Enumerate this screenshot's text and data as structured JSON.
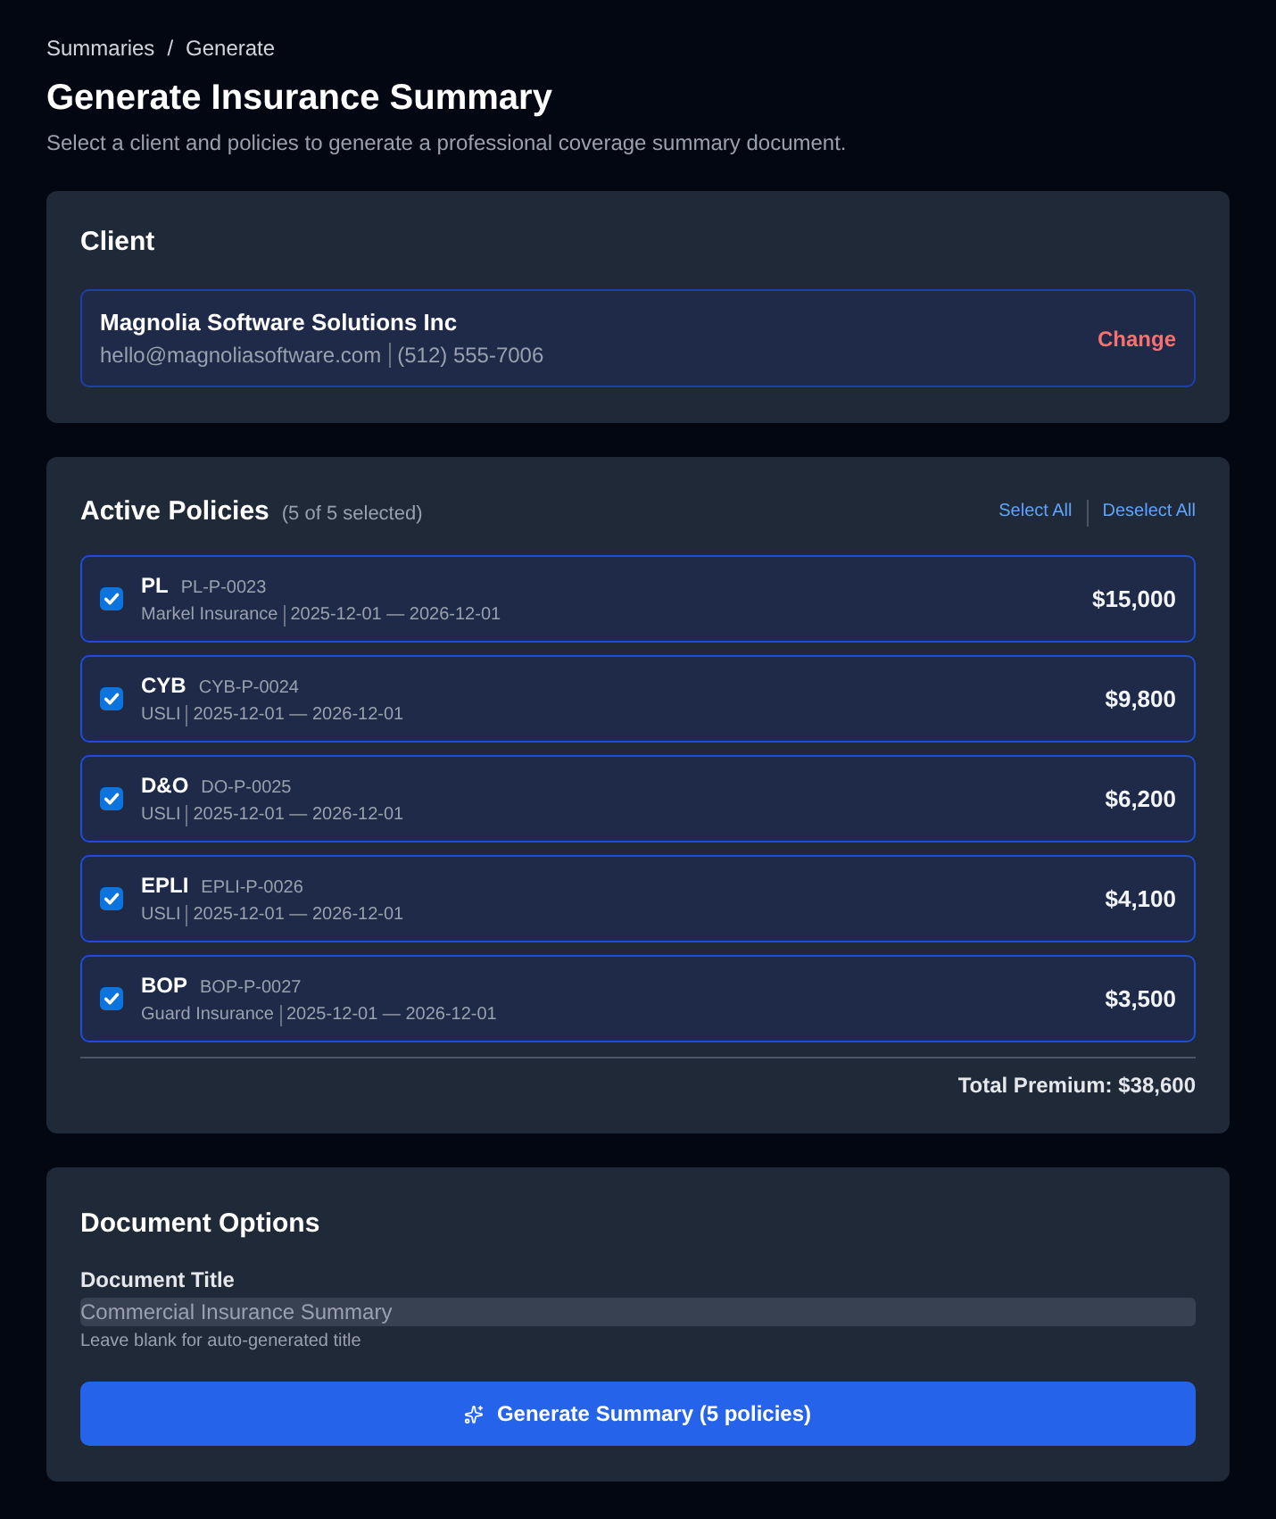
{
  "breadcrumb": {
    "items": [
      "Summaries",
      "Generate"
    ],
    "separator": "/"
  },
  "header": {
    "title": "Generate Insurance Summary",
    "subtitle": "Select a client and policies to generate a professional coverage summary document."
  },
  "client": {
    "heading": "Client",
    "name": "Magnolia Software Solutions Inc",
    "email": "hello@magnoliasoftware.com",
    "phone": "(512) 555-7006",
    "change_link": "Change"
  },
  "policies": {
    "heading": "Active Policies",
    "count": "(5 of 5 selected)",
    "select_all": "Select All",
    "deselect_all": "Deselect All",
    "items": [
      {
        "code": "PL",
        "number": "PL-P-0023",
        "carrier": "Markel Insurance",
        "term": "2025-12-01 — 2026-12-01",
        "premium": "$15,000",
        "checked": true
      },
      {
        "code": "CYB",
        "number": "CYB-P-0024",
        "carrier": "USLI",
        "term": "2025-12-01 — 2026-12-01",
        "premium": "$9,800",
        "checked": true
      },
      {
        "code": "D&O",
        "number": "DO-P-0025",
        "carrier": "USLI",
        "term": "2025-12-01 — 2026-12-01",
        "premium": "$6,200",
        "checked": true
      },
      {
        "code": "EPLI",
        "number": "EPLI-P-0026",
        "carrier": "USLI",
        "term": "2025-12-01 — 2026-12-01",
        "premium": "$4,100",
        "checked": true
      },
      {
        "code": "BOP",
        "number": "BOP-P-0027",
        "carrier": "Guard Insurance",
        "term": "2025-12-01 — 2026-12-01",
        "premium": "$3,500",
        "checked": true
      }
    ],
    "total": "Total Premium: $38,600"
  },
  "document_options": {
    "heading": "Document Options",
    "title_label": "Document Title",
    "title_field": {
      "placeholder": "Commercial Insurance Summary"
    },
    "hint": "Leave blank for auto-generated title",
    "generate_button": "Generate Summary (5 policies)"
  }
}
